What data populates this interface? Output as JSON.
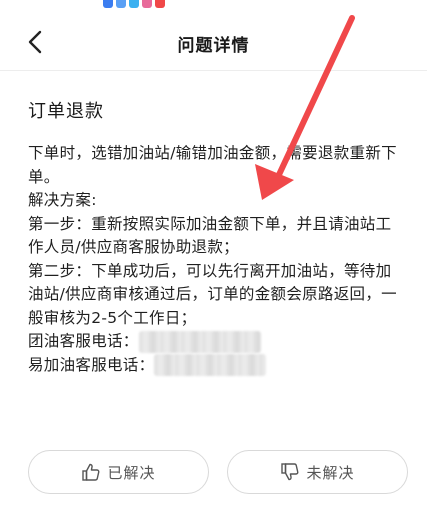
{
  "header": {
    "title": "问题详情"
  },
  "status_bar": {
    "icons": [
      "app-icon-1",
      "app-icon-2",
      "app-icon-3",
      "app-icon-4",
      "app-icon-5"
    ],
    "colors": [
      "#3b7df0",
      "#5aa0f5",
      "#3bb0f0",
      "#e86a9a",
      "#f04848"
    ]
  },
  "question": {
    "title": "订单退款"
  },
  "answer": {
    "line1": "下单时，选错加油站/输错加油金额，需要退款重新下单。",
    "line2": "解决方案:",
    "line3": "第一步：重新按照实际加油金额下单，并且请油站工作人员/供应商客服协助退款；",
    "line4": "第二步：下单成功后，可以先行离开加油站，等待加油站/供应商审核通过后，订单的金额会原路返回，一般审核为2-5个工作日；",
    "tuanyou_label": "团油客服电话：",
    "yijiayou_label": "易加油客服电话："
  },
  "feedback": {
    "solved_label": "已解决",
    "unsolved_label": "未解决"
  },
  "colors": {
    "arrow": "#f0484a",
    "border": "#d9d9d9",
    "text": "#1f1f1f"
  }
}
